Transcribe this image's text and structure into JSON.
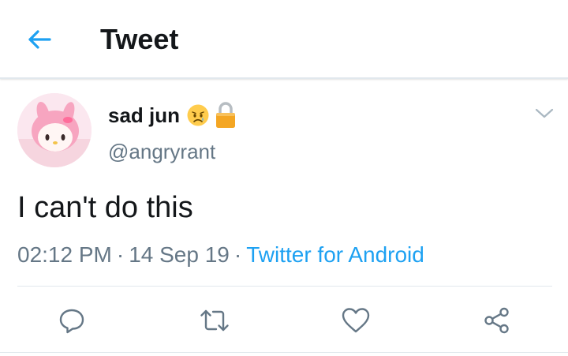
{
  "header": {
    "title": "Tweet",
    "back_icon": "arrow-left-icon"
  },
  "tweet": {
    "author_name": "sad jun",
    "author_handle": "@angryrant",
    "text": "I can't do this",
    "time": "02:12 PM",
    "date": "14 Sep 19",
    "separator": "·",
    "source": "Twitter for Android",
    "name_icons": [
      "sad-face-emoji-icon",
      "lock-icon"
    ]
  },
  "actions": {
    "icons": [
      "reply-icon",
      "retweet-icon",
      "like-icon",
      "share-icon"
    ]
  },
  "colors": {
    "accent": "#1da1f2",
    "secondary_text": "#657786",
    "divider": "#e1e8ed",
    "icon": "#657786"
  }
}
